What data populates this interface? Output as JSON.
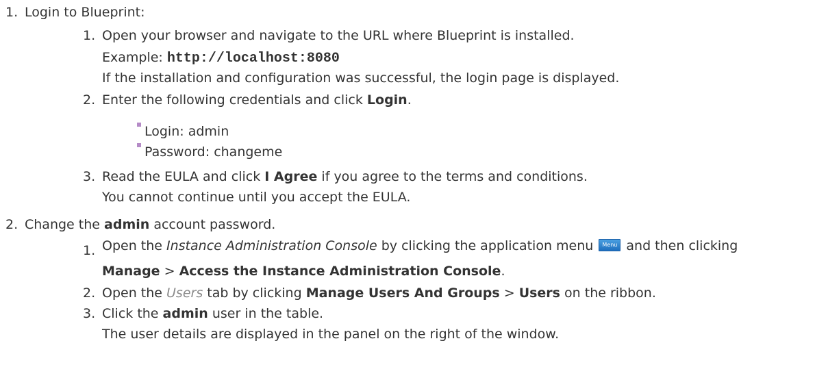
{
  "steps": {
    "s1": {
      "num": "1.",
      "text": "Login to Blueprint:",
      "sub1": {
        "num": "1.",
        "text": "Open your browser and navigate to the URL where Blueprint is installed.",
        "example_label": "Example: ",
        "example_url": "http://localhost:8080",
        "result": "If the installation and configuration was successful, the login page is displayed."
      },
      "sub2": {
        "num": "2.",
        "text_a": "Enter the following credentials and click ",
        "text_bold": "Login",
        "text_b": ".",
        "bullets": [
          "Login: admin",
          "Password: changeme"
        ]
      },
      "sub3": {
        "num": "3.",
        "text_a": "Read the EULA and click ",
        "text_bold": "I Agree",
        "text_b": " if you agree to the terms and conditions.",
        "note": "You cannot continue until you accept the EULA."
      }
    },
    "s2": {
      "num": "2.",
      "text_a": "Change the ",
      "text_bold": "admin",
      "text_b": " account password.",
      "sub1": {
        "num": "1.",
        "text_a": "Open the ",
        "text_ital": "Instance Administration Console",
        "text_b": " by clicking the application menu ",
        "menu_label": "Menu",
        "text_c": " and then clicking",
        "bold_a": "Manage",
        "sep": " > ",
        "bold_b": "Access the Instance Administration Console",
        "end": "."
      },
      "sub2": {
        "num": "2.",
        "text_a": "Open the ",
        "text_ital": "Users",
        "text_b": " tab by clicking ",
        "bold_a": "Manage Users And Groups",
        "sep": " > ",
        "bold_b": "Users",
        "text_c": " on the ribbon."
      },
      "sub3": {
        "num": "3.",
        "text_a": "Click the ",
        "text_bold": "admin",
        "text_b": " user in the table.",
        "note": "The user details are displayed in the panel on the right of the window."
      }
    }
  }
}
